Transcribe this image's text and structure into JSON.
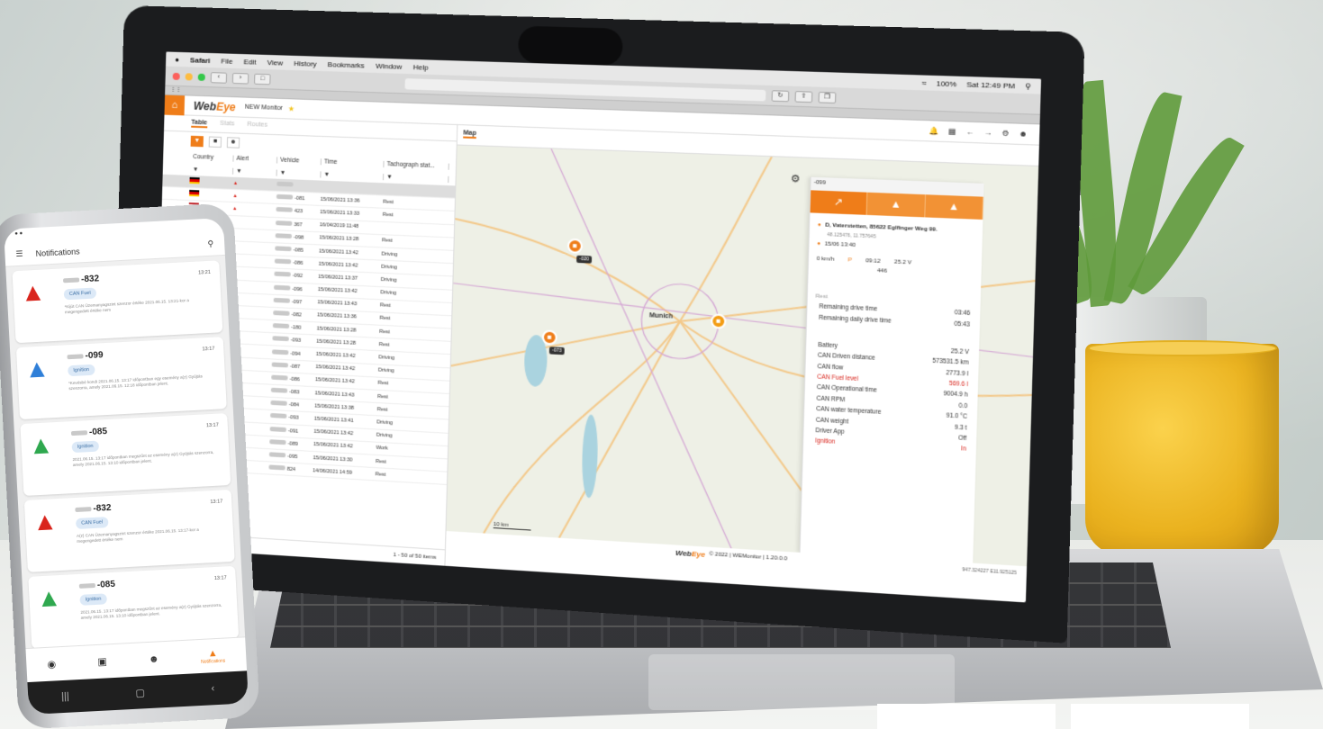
{
  "menubar": {
    "apple": "",
    "items": [
      "Safari",
      "File",
      "Edit",
      "View",
      "History",
      "Bookmarks",
      "Window",
      "Help"
    ],
    "battery": "100%",
    "clock": "Sat 12:49 PM"
  },
  "app": {
    "logo_a": "Web",
    "logo_b": "Eye",
    "title": "NEW Monitor"
  },
  "left": {
    "tabs": [
      "Table",
      "Stats",
      "Routes"
    ],
    "columns": [
      "Country",
      "Alert",
      "Vehicle",
      "Time",
      "Tachograph stat..."
    ],
    "rows": [
      {
        "flag": "de",
        "alert": true,
        "vehicle": "",
        "time": "",
        "status": "",
        "sel": true
      },
      {
        "flag": "de",
        "alert": true,
        "vehicle": "-081",
        "time": "15/06/2021 13:36",
        "status": "Rest"
      },
      {
        "flag": "hu",
        "alert": true,
        "vehicle": "423",
        "time": "15/06/2021 13:33",
        "status": "Rest"
      },
      {
        "flag": "hu",
        "vehicle": "367",
        "time": "16/04/2019 11:48",
        "status": ""
      },
      {
        "flag": "hu",
        "vehicle": "-098",
        "time": "15/06/2021 13:28",
        "status": "Rest"
      },
      {
        "flag": "hu",
        "vehicle": "-085",
        "time": "15/06/2021 13:42",
        "status": "Driving"
      },
      {
        "flag": "de",
        "vehicle": "-086",
        "time": "15/06/2021 13:42",
        "status": "Driving"
      },
      {
        "flag": "hu",
        "vehicle": "-092",
        "time": "15/06/2021 13:37",
        "status": "Driving"
      },
      {
        "flag": "hu",
        "vehicle": "-096",
        "time": "15/06/2021 13:42",
        "status": "Driving"
      },
      {
        "flag": "de",
        "vehicle": "-097",
        "time": "15/06/2021 13:43",
        "status": "Rest"
      },
      {
        "flag": "hu",
        "vehicle": "-082",
        "time": "15/06/2021 13:36",
        "status": "Rest"
      },
      {
        "flag": "hu",
        "vehicle": "-180",
        "time": "15/06/2021 13:28",
        "status": "Rest"
      },
      {
        "flag": "hu",
        "vehicle": "-093",
        "time": "15/06/2021 13:28",
        "status": "Rest"
      },
      {
        "flag": "de",
        "vehicle": "-094",
        "time": "15/06/2021 13:42",
        "status": "Driving"
      },
      {
        "flag": "hu",
        "vehicle": "-087",
        "time": "15/06/2021 13:42",
        "status": "Driving"
      },
      {
        "flag": "hu",
        "vehicle": "-086",
        "time": "15/06/2021 13:42",
        "status": "Rest"
      },
      {
        "flag": "hu",
        "vehicle": "-083",
        "time": "15/06/2021 13:43",
        "status": "Rest"
      },
      {
        "flag": "hu",
        "vehicle": "-084",
        "time": "15/06/2021 13:38",
        "status": "Rest"
      },
      {
        "flag": "hu",
        "vehicle": "-093",
        "time": "15/06/2021 13:41",
        "status": "Driving"
      },
      {
        "flag": "hu",
        "vehicle": "-091",
        "time": "15/06/2021 13:42",
        "status": "Driving"
      },
      {
        "flag": "hu",
        "vehicle": "-089",
        "time": "15/06/2021 13:42",
        "status": "Work"
      },
      {
        "flag": "de",
        "vehicle": "-095",
        "time": "15/06/2021 13:30",
        "status": "Rest"
      },
      {
        "flag": "de",
        "vehicle": "824",
        "time": "14/06/2021 14:59",
        "status": "Rest"
      }
    ],
    "pager_page": "1",
    "pager_info": "1 - 50 of 50 items"
  },
  "map": {
    "tab": "Map",
    "city": "Munich",
    "scale": "10 km",
    "pin_a_label": "-020",
    "pin_b_label": "-073"
  },
  "panel": {
    "vehicle": "-099",
    "address": "D, Vaterstetten, 85622 Eglfinger Weg 99.",
    "coords": "48.125476, 11.757645",
    "time": "15/06  13:40",
    "speed": "0 km/h",
    "parking": "09:12",
    "battery_short": "25.2 V",
    "odometer": "446",
    "driver_status": "Rest",
    "remaining_drive": "Remaining drive time",
    "remaining_drive_val": "03:46",
    "remaining_daily": "Remaining daily drive time",
    "remaining_daily_val": "05:43",
    "sensors": [
      {
        "k": "Battery",
        "v": "25.2 V"
      },
      {
        "k": "CAN Driven distance",
        "v": "573531.5 km"
      },
      {
        "k": "CAN flow",
        "v": "2773.9 l"
      },
      {
        "k": "CAN Fuel level",
        "v": "569.6 l",
        "red": true
      },
      {
        "k": "CAN Operational time",
        "v": "9004.9 h"
      },
      {
        "k": "CAN RPM",
        "v": "0.0"
      },
      {
        "k": "CAN water temperature",
        "v": "91.0 °C"
      },
      {
        "k": "CAN weight",
        "v": "9.3 t"
      },
      {
        "k": "Driver App",
        "v": "Off"
      },
      {
        "k": "Ignition",
        "v": "In",
        "red": true
      }
    ]
  },
  "footer": {
    "logo_a": "Web",
    "logo_b": "Eye",
    "copy": "© 2022 | WEMonitor | 1.20.0.0",
    "coords": "947.324227 E11.925125"
  },
  "phone": {
    "title": "Notifications",
    "cards": [
      {
        "title": "-832",
        "time": "13:21",
        "chip": "CAN Fuel",
        "color": "#d9251d",
        "text": "*Kijút CAN Üzemanyagszint szenzor értéke 2021.06.15. 13:21-kor a megengedett értéke nem"
      },
      {
        "title": "-099",
        "time": "13:17",
        "chip": "Ignition",
        "color": "#2f7fd8",
        "text": "*Kevésbé kondi 2021.06.15. 13:17 időpontban egy esemény a(z) Gyújtás szenzorra, amely 2021.06.15. 12:18 időpontban jelent."
      },
      {
        "title": "-085",
        "time": "13:17",
        "chip": "Ignition",
        "color": "#2fa84f",
        "text": "2021.06.15. 13:17 időpontban megszűnt az esemény a(z) Gyújtás szenzorra, amely 2021.06.15. 13:10 időpontban jelent."
      },
      {
        "title": "-832",
        "time": "13:17",
        "chip": "CAN Fuel",
        "color": "#d9251d",
        "text": "A(z) CAN Üzemanyagszint szenzor értéke 2021.06.15. 13:17-kor a megengedett értéke nem"
      },
      {
        "title": "-085",
        "time": "13:17",
        "chip": "Ignition",
        "color": "#2fa84f",
        "text": "2021.06.15. 13:17 időpontban megszűnt az esemény a(z) Gyújtás szenzorra, amely 2021.06.15. 13:10 időpontban jelent."
      }
    ],
    "nav_active": "Notifications"
  }
}
